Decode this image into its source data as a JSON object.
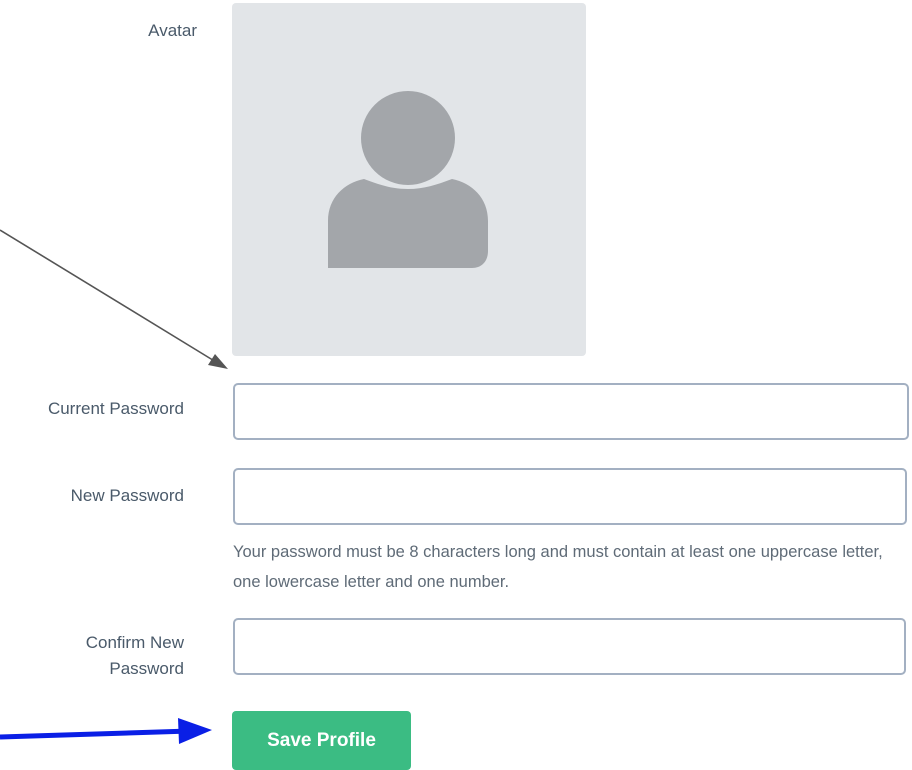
{
  "avatar": {
    "label": "Avatar",
    "icon": "user-silhouette-icon",
    "placeholder_bg": "#e2e5e8",
    "silhouette_color": "#a3a6aa"
  },
  "fields": {
    "current_password": {
      "label": "Current Password",
      "value": ""
    },
    "new_password": {
      "label": "New Password",
      "value": ""
    },
    "new_password_help": "Your password must be 8 characters long and must contain at least one uppercase letter, one lowercase letter and one number.",
    "confirm_password": {
      "label_line1": "Confirm New",
      "label_line2": "Password",
      "value": ""
    }
  },
  "actions": {
    "save_label": "Save Profile",
    "save_color": "#3bbc83"
  },
  "annotations": {
    "gray_arrow_color": "#555555",
    "blue_arrow_color": "#0a1fe6"
  }
}
